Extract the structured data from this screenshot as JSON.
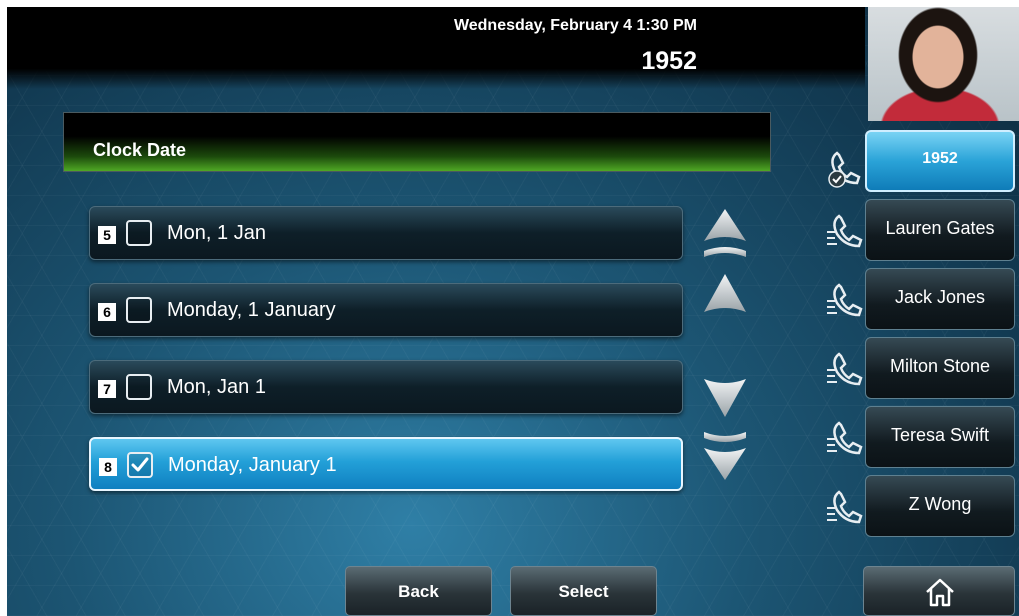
{
  "header": {
    "datetime": "Wednesday, February 4  1:30 PM",
    "extension": "1952"
  },
  "title": "Clock Date",
  "options": [
    {
      "num": "5",
      "label": "Mon, 1 Jan",
      "checked": false
    },
    {
      "num": "6",
      "label": "Monday, 1 January",
      "checked": false
    },
    {
      "num": "7",
      "label": "Mon, Jan 1",
      "checked": false
    },
    {
      "num": "8",
      "label": "Monday, January 1",
      "checked": true
    }
  ],
  "scroll": [
    "page-up-icon",
    "up-arrow-icon",
    "down-arrow-icon",
    "page-down-icon"
  ],
  "lines": [
    {
      "label": "1952",
      "active": true,
      "icon": "registered-line-icon"
    },
    {
      "label": "Lauren Gates",
      "active": false,
      "icon": "handset-icon"
    },
    {
      "label": "Jack Jones",
      "active": false,
      "icon": "handset-icon"
    },
    {
      "label": "Milton Stone",
      "active": false,
      "icon": "handset-icon"
    },
    {
      "label": "Teresa Swift",
      "active": false,
      "icon": "handset-icon"
    },
    {
      "label": "Z Wong",
      "active": false,
      "icon": "handset-icon"
    }
  ],
  "softkeys": {
    "back": "Back",
    "select": "Select",
    "home_icon": "home-icon"
  },
  "colors": {
    "selected": "#23a0d8",
    "title_green": "#4fa824"
  }
}
